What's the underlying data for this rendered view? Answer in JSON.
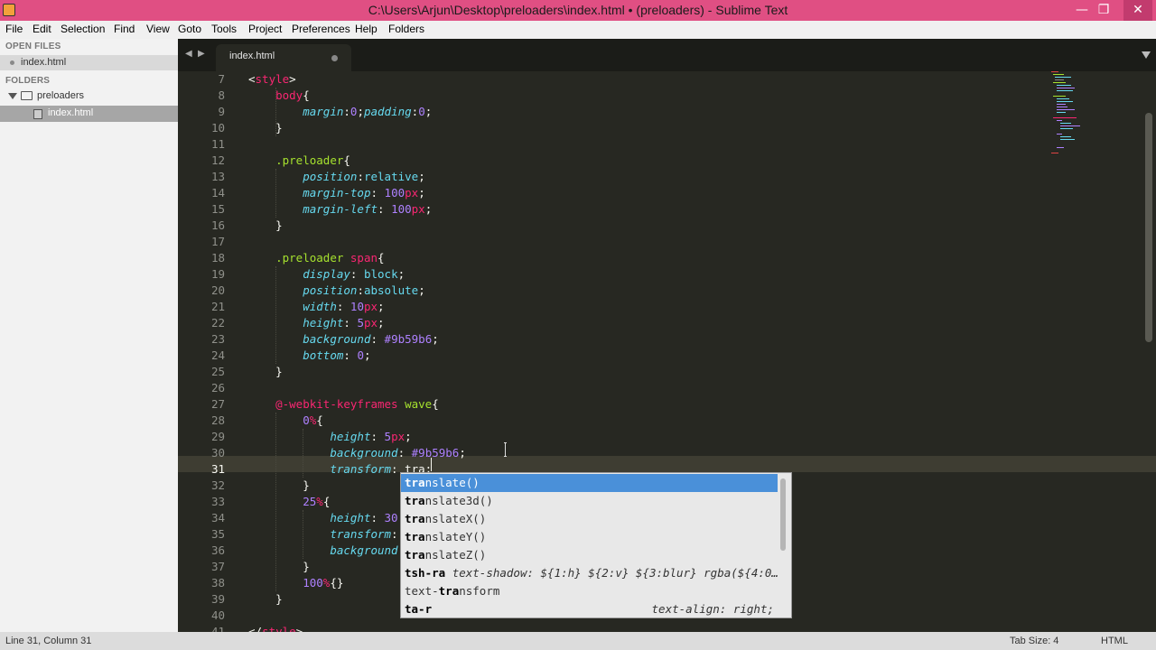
{
  "window": {
    "title": "C:\\Users\\Arjun\\Desktop\\preloaders\\index.html • (preloaders) - Sublime Text",
    "minimize_glyph": "—",
    "restore_glyph": "❐",
    "close_glyph": "✕"
  },
  "menu": [
    "File",
    "Edit",
    "Selection",
    "Find",
    "View",
    "Goto",
    "Tools",
    "Project",
    "Preferences",
    "Help",
    "Folders"
  ],
  "sidebar": {
    "open_files_heading": "OPEN FILES",
    "open_file": "index.html",
    "folders_heading": "FOLDERS",
    "folder": "preloaders",
    "folder_file": "index.html"
  },
  "tabs": {
    "back_glyph": "◀",
    "forward_glyph": "▶",
    "active_tab": "index.html"
  },
  "editor": {
    "line_numbers": [
      "7",
      "8",
      "9",
      "10",
      "11",
      "12",
      "13",
      "14",
      "15",
      "16",
      "17",
      "18",
      "19",
      "20",
      "21",
      "22",
      "23",
      "24",
      "25",
      "26",
      "27",
      "28",
      "29",
      "30",
      "31",
      "32",
      "33",
      "34",
      "35",
      "36",
      "37",
      "38",
      "39",
      "40",
      "41"
    ],
    "current_line": "31"
  },
  "autocomplete": {
    "items": [
      {
        "match": "tra",
        "rest": "nslate()",
        "hint": ""
      },
      {
        "match": "tra",
        "rest": "nslate3d()",
        "hint": ""
      },
      {
        "match": "tra",
        "rest": "nslateX()",
        "hint": ""
      },
      {
        "match": "tra",
        "rest": "nslateY()",
        "hint": ""
      },
      {
        "match": "tra",
        "rest": "nslateZ()",
        "hint": ""
      },
      {
        "match": "t",
        "rest": "sh-ra",
        "hint": "text-shadow: ${1:h} ${2:v} ${3:blur} rgba(${4:0…"
      },
      {
        "match": "text-tra",
        "rest": "nsform",
        "hint": ""
      },
      {
        "match": "ta-r",
        "rest": "",
        "hint": "text-align: right;"
      }
    ]
  },
  "status": {
    "position": "Line 31, Column 31",
    "tab_size": "Tab Size: 4",
    "syntax": "HTML"
  },
  "colors": {
    "titlebar": "#e04f83",
    "editor_bg": "#272822",
    "tag": "#f92672",
    "property": "#66d9ef",
    "number": "#ae81ff",
    "identifier": "#a6e22e",
    "selection": "#4a90d9"
  }
}
